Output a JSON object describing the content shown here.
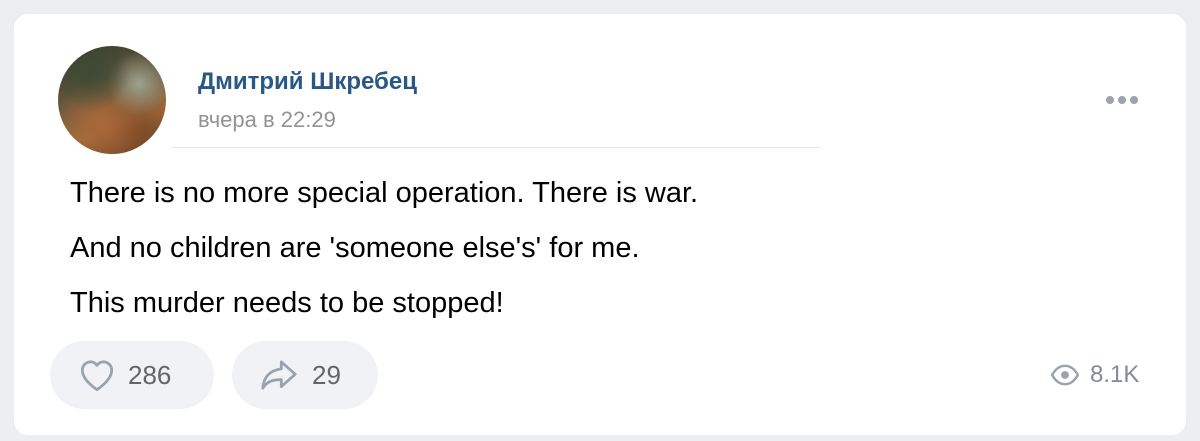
{
  "post": {
    "author_name": "Дмитрий Шкребец",
    "timestamp": "вчера в 22:29",
    "text_lines": [
      "There is no more special operation. There is war.",
      "And no children are 'someone else's' for me.",
      "This murder needs to be stopped!"
    ]
  },
  "actions": {
    "likes": "286",
    "shares": "29",
    "views": "8.1K"
  },
  "icons": {
    "avatar": "user-photo",
    "more": "more-horizontal-icon",
    "like": "heart-outline-icon",
    "share": "share-arrow-icon",
    "views": "eye-icon"
  },
  "colors": {
    "author_link": "#2a5885",
    "secondary_text": "#939393",
    "icon_gray": "#99a2ad",
    "pill_bg": "#f0f2f5",
    "page_bg": "#edeef0"
  }
}
